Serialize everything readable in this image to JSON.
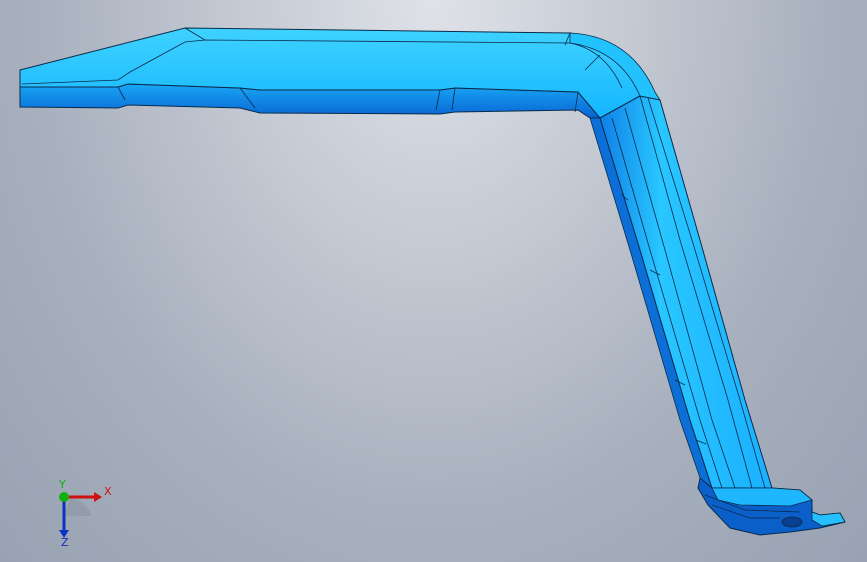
{
  "viewport": {
    "background_top": "#e0e3e8",
    "background_bottom": "#98a2b2"
  },
  "part": {
    "name": "bent bracket",
    "face_color": "#1ec3ff",
    "edge_color": "#0a2a4a",
    "shade_color": "#0a6fd6"
  },
  "triad": {
    "x_label": "X",
    "y_label": "Y",
    "z_label": "Z",
    "x_color": "#d01010",
    "y_color": "#10b010",
    "z_color": "#1030c0"
  }
}
